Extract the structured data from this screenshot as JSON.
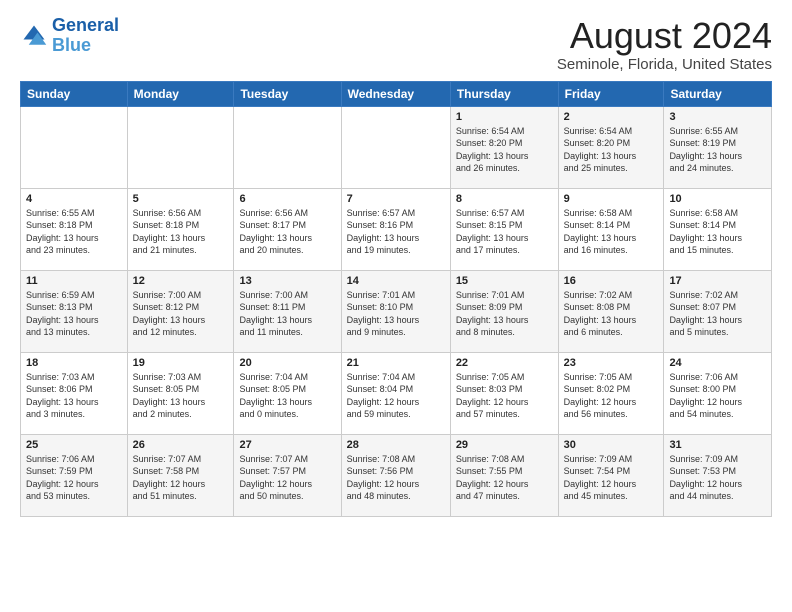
{
  "logo": {
    "line1": "General",
    "line2": "Blue"
  },
  "title": "August 2024",
  "subtitle": "Seminole, Florida, United States",
  "weekdays": [
    "Sunday",
    "Monday",
    "Tuesday",
    "Wednesday",
    "Thursday",
    "Friday",
    "Saturday"
  ],
  "weeks": [
    [
      {
        "day": "",
        "info": ""
      },
      {
        "day": "",
        "info": ""
      },
      {
        "day": "",
        "info": ""
      },
      {
        "day": "",
        "info": ""
      },
      {
        "day": "1",
        "info": "Sunrise: 6:54 AM\nSunset: 8:20 PM\nDaylight: 13 hours\nand 26 minutes."
      },
      {
        "day": "2",
        "info": "Sunrise: 6:54 AM\nSunset: 8:20 PM\nDaylight: 13 hours\nand 25 minutes."
      },
      {
        "day": "3",
        "info": "Sunrise: 6:55 AM\nSunset: 8:19 PM\nDaylight: 13 hours\nand 24 minutes."
      }
    ],
    [
      {
        "day": "4",
        "info": "Sunrise: 6:55 AM\nSunset: 8:18 PM\nDaylight: 13 hours\nand 23 minutes."
      },
      {
        "day": "5",
        "info": "Sunrise: 6:56 AM\nSunset: 8:18 PM\nDaylight: 13 hours\nand 21 minutes."
      },
      {
        "day": "6",
        "info": "Sunrise: 6:56 AM\nSunset: 8:17 PM\nDaylight: 13 hours\nand 20 minutes."
      },
      {
        "day": "7",
        "info": "Sunrise: 6:57 AM\nSunset: 8:16 PM\nDaylight: 13 hours\nand 19 minutes."
      },
      {
        "day": "8",
        "info": "Sunrise: 6:57 AM\nSunset: 8:15 PM\nDaylight: 13 hours\nand 17 minutes."
      },
      {
        "day": "9",
        "info": "Sunrise: 6:58 AM\nSunset: 8:14 PM\nDaylight: 13 hours\nand 16 minutes."
      },
      {
        "day": "10",
        "info": "Sunrise: 6:58 AM\nSunset: 8:14 PM\nDaylight: 13 hours\nand 15 minutes."
      }
    ],
    [
      {
        "day": "11",
        "info": "Sunrise: 6:59 AM\nSunset: 8:13 PM\nDaylight: 13 hours\nand 13 minutes."
      },
      {
        "day": "12",
        "info": "Sunrise: 7:00 AM\nSunset: 8:12 PM\nDaylight: 13 hours\nand 12 minutes."
      },
      {
        "day": "13",
        "info": "Sunrise: 7:00 AM\nSunset: 8:11 PM\nDaylight: 13 hours\nand 11 minutes."
      },
      {
        "day": "14",
        "info": "Sunrise: 7:01 AM\nSunset: 8:10 PM\nDaylight: 13 hours\nand 9 minutes."
      },
      {
        "day": "15",
        "info": "Sunrise: 7:01 AM\nSunset: 8:09 PM\nDaylight: 13 hours\nand 8 minutes."
      },
      {
        "day": "16",
        "info": "Sunrise: 7:02 AM\nSunset: 8:08 PM\nDaylight: 13 hours\nand 6 minutes."
      },
      {
        "day": "17",
        "info": "Sunrise: 7:02 AM\nSunset: 8:07 PM\nDaylight: 13 hours\nand 5 minutes."
      }
    ],
    [
      {
        "day": "18",
        "info": "Sunrise: 7:03 AM\nSunset: 8:06 PM\nDaylight: 13 hours\nand 3 minutes."
      },
      {
        "day": "19",
        "info": "Sunrise: 7:03 AM\nSunset: 8:05 PM\nDaylight: 13 hours\nand 2 minutes."
      },
      {
        "day": "20",
        "info": "Sunrise: 7:04 AM\nSunset: 8:05 PM\nDaylight: 13 hours\nand 0 minutes."
      },
      {
        "day": "21",
        "info": "Sunrise: 7:04 AM\nSunset: 8:04 PM\nDaylight: 12 hours\nand 59 minutes."
      },
      {
        "day": "22",
        "info": "Sunrise: 7:05 AM\nSunset: 8:03 PM\nDaylight: 12 hours\nand 57 minutes."
      },
      {
        "day": "23",
        "info": "Sunrise: 7:05 AM\nSunset: 8:02 PM\nDaylight: 12 hours\nand 56 minutes."
      },
      {
        "day": "24",
        "info": "Sunrise: 7:06 AM\nSunset: 8:00 PM\nDaylight: 12 hours\nand 54 minutes."
      }
    ],
    [
      {
        "day": "25",
        "info": "Sunrise: 7:06 AM\nSunset: 7:59 PM\nDaylight: 12 hours\nand 53 minutes."
      },
      {
        "day": "26",
        "info": "Sunrise: 7:07 AM\nSunset: 7:58 PM\nDaylight: 12 hours\nand 51 minutes."
      },
      {
        "day": "27",
        "info": "Sunrise: 7:07 AM\nSunset: 7:57 PM\nDaylight: 12 hours\nand 50 minutes."
      },
      {
        "day": "28",
        "info": "Sunrise: 7:08 AM\nSunset: 7:56 PM\nDaylight: 12 hours\nand 48 minutes."
      },
      {
        "day": "29",
        "info": "Sunrise: 7:08 AM\nSunset: 7:55 PM\nDaylight: 12 hours\nand 47 minutes."
      },
      {
        "day": "30",
        "info": "Sunrise: 7:09 AM\nSunset: 7:54 PM\nDaylight: 12 hours\nand 45 minutes."
      },
      {
        "day": "31",
        "info": "Sunrise: 7:09 AM\nSunset: 7:53 PM\nDaylight: 12 hours\nand 44 minutes."
      }
    ]
  ]
}
